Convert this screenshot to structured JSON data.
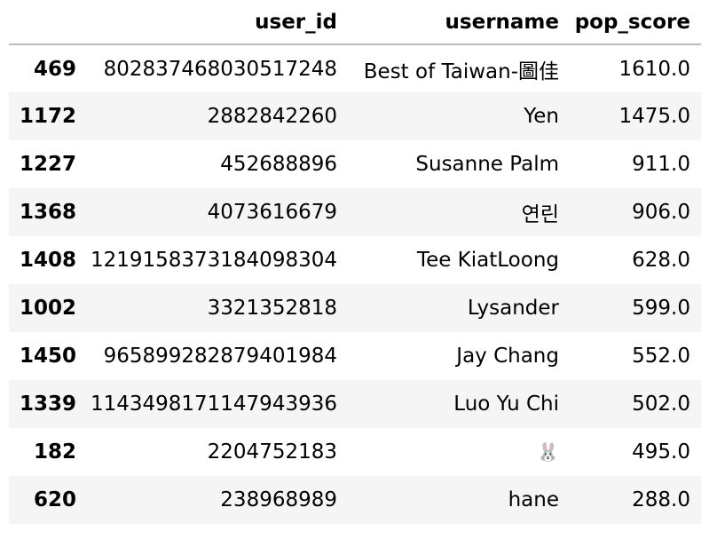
{
  "table": {
    "columns": {
      "index": "",
      "user_id": "user_id",
      "username": "username",
      "pop_score": "pop_score"
    },
    "rows": [
      {
        "index": "469",
        "user_id": "802837468030517248",
        "username": "Best of Taiwan-圖佳",
        "pop_score": "1610.0"
      },
      {
        "index": "1172",
        "user_id": "2882842260",
        "username": "Yen",
        "pop_score": "1475.0"
      },
      {
        "index": "1227",
        "user_id": "452688896",
        "username": "Susanne Palm",
        "pop_score": "911.0"
      },
      {
        "index": "1368",
        "user_id": "4073616679",
        "username": "연린",
        "pop_score": "906.0"
      },
      {
        "index": "1408",
        "user_id": "1219158373184098304",
        "username": "Tee KiatLoong",
        "pop_score": "628.0"
      },
      {
        "index": "1002",
        "user_id": "3321352818",
        "username": "Lysander",
        "pop_score": "599.0"
      },
      {
        "index": "1450",
        "user_id": "965899282879401984",
        "username": "Jay Chang",
        "pop_score": "552.0"
      },
      {
        "index": "1339",
        "user_id": "1143498171147943936",
        "username": "Luo Yu Chi",
        "pop_score": "502.0"
      },
      {
        "index": "182",
        "user_id": "2204752183",
        "username": "🐰",
        "pop_score": "495.0"
      },
      {
        "index": "620",
        "user_id": "238968989",
        "username": "hane",
        "pop_score": "288.0"
      }
    ]
  },
  "icons": {
    "row_9_username": "bunny-icon"
  }
}
